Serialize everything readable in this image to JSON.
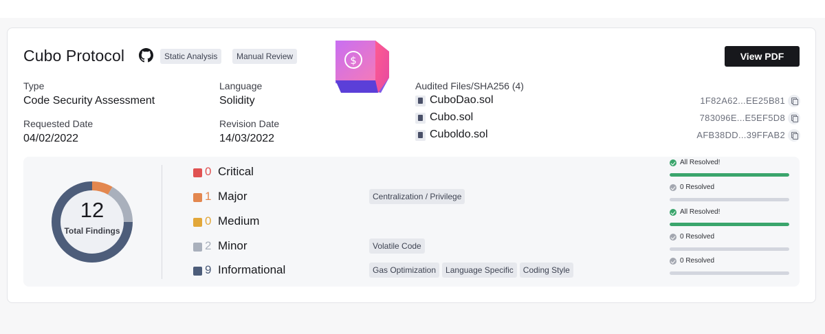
{
  "header": {
    "title": "Cubo Protocol",
    "tags": [
      "Static Analysis",
      "Manual Review"
    ],
    "view_pdf_label": "View PDF"
  },
  "meta": {
    "type_label": "Type",
    "type_value": "Code Security Assessment",
    "language_label": "Language",
    "language_value": "Solidity",
    "requested_label": "Requested Date",
    "requested_value": "04/02/2022",
    "revision_label": "Revision Date",
    "revision_value": "14/03/2022"
  },
  "files": {
    "heading": "Audited Files/SHA256 (4)",
    "items": [
      {
        "name": "CuboDao.sol",
        "hash": "1F82A62...EE25B81"
      },
      {
        "name": "Cubo.sol",
        "hash": "783096E...E5EF5D8"
      },
      {
        "name": "Cuboldo.sol",
        "hash": "AFB38DD...39FFAB2"
      }
    ]
  },
  "summary": {
    "total": "12",
    "total_label": "Total Findings"
  },
  "severities": [
    {
      "name": "Critical",
      "count": "0",
      "color": "#e05252",
      "categories": [],
      "status": "All Resolved!",
      "resolved_fraction": 1,
      "resolved": true
    },
    {
      "name": "Major",
      "count": "1",
      "color": "#e3874f",
      "categories": [
        "Centralization / Privilege"
      ],
      "status": "0 Resolved",
      "resolved_fraction": 0,
      "resolved": false
    },
    {
      "name": "Medium",
      "count": "0",
      "color": "#e2a73a",
      "categories": [],
      "status": "All Resolved!",
      "resolved_fraction": 1,
      "resolved": true
    },
    {
      "name": "Minor",
      "count": "2",
      "color": "#a9b0bc",
      "categories": [
        "Volatile Code"
      ],
      "status": "0 Resolved",
      "resolved_fraction": 0,
      "resolved": false
    },
    {
      "name": "Informational",
      "count": "9",
      "color": "#4d5d7a",
      "categories": [
        "Gas Optimization",
        "Language Specific",
        "Coding Style"
      ],
      "status": "0 Resolved",
      "resolved_fraction": 0,
      "resolved": false
    }
  ],
  "colors": {
    "resolved_green": "#3aa56c",
    "unresolved_gray": "#a3a7b0"
  }
}
